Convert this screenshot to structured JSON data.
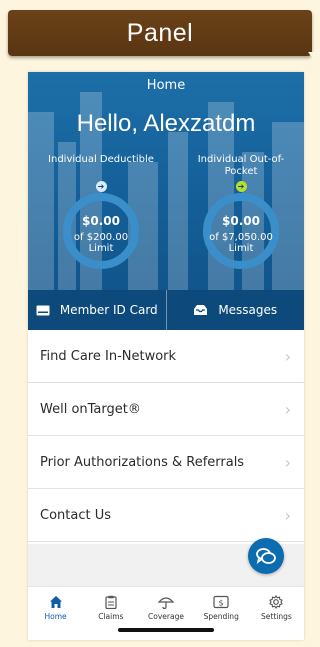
{
  "banner": {
    "title": "Panel"
  },
  "header": {
    "screen_title": "Home",
    "greeting": "Hello, Alexzatdm"
  },
  "gauges": [
    {
      "label": "Individual Deductible",
      "amount": "$0.00",
      "limit": "of $200.00 Limit",
      "fraction_used": 0,
      "arrow_color": "#d7ecff"
    },
    {
      "label": "Individual Out-of-Pocket",
      "amount": "$0.00",
      "limit": "of $7,050.00 Limit",
      "fraction_used": 0,
      "arrow_color": "#b8e02a"
    }
  ],
  "actions": {
    "member_id": "Member ID Card",
    "messages": "Messages"
  },
  "menu": [
    {
      "label": "Find Care In-Network"
    },
    {
      "label": "Well onTarget®"
    },
    {
      "label": "Prior Authorizations & Referrals"
    },
    {
      "label": "Contact Us"
    }
  ],
  "tabs": [
    {
      "label": "Home",
      "icon": "home-icon"
    },
    {
      "label": "Claims",
      "icon": "clipboard-icon"
    },
    {
      "label": "Coverage",
      "icon": "umbrella-icon"
    },
    {
      "label": "Spending",
      "icon": "dollar-icon"
    },
    {
      "label": "Settings",
      "icon": "gear-icon"
    }
  ],
  "colors": {
    "accent": "#0d5ea6",
    "hero": "#15609a",
    "action_bar": "#0d4a7b",
    "banner": "#6b4218"
  }
}
